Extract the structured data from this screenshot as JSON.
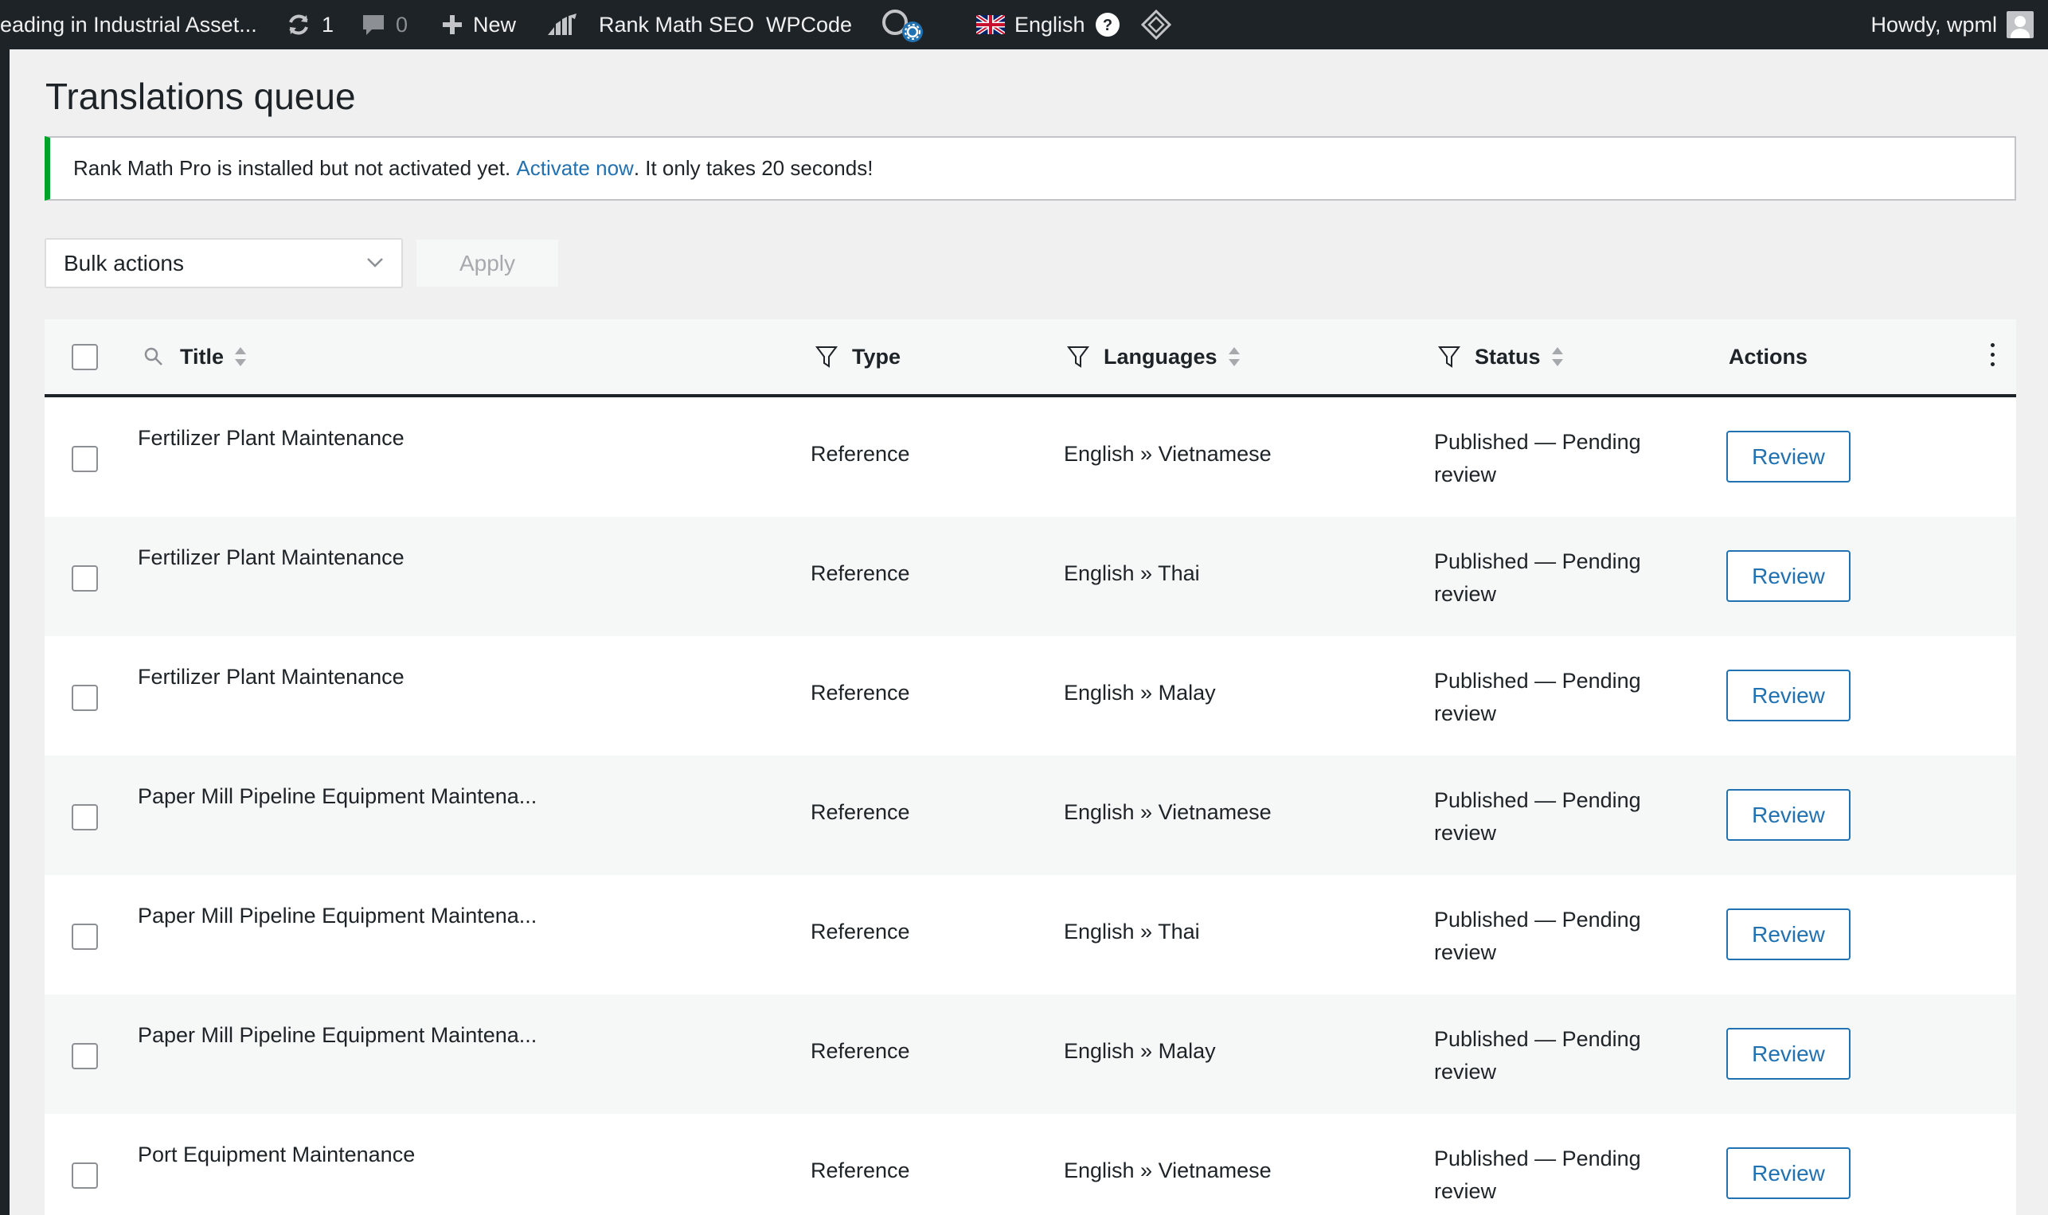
{
  "admin_bar": {
    "site_name": "eading in Industrial Asset...",
    "updates_count": "1",
    "comments_count": "0",
    "new_label": "New",
    "rank_math_label": "Rank Math SEO",
    "wpcode_label": "WPCode",
    "language_label": "English",
    "greeting": "Howdy, wpml"
  },
  "page": {
    "title": "Translations queue"
  },
  "notice": {
    "text_before": "Rank Math Pro is installed but not activated yet. ",
    "link_text": "Activate now",
    "text_after": ". It only takes 20 seconds!"
  },
  "bulk": {
    "select_label": "Bulk actions",
    "apply_label": "Apply"
  },
  "table": {
    "columns": {
      "title": "Title",
      "type": "Type",
      "languages": "Languages",
      "status": "Status",
      "actions": "Actions"
    },
    "rows": [
      {
        "title": "Fertilizer Plant Maintenance",
        "type": "Reference",
        "languages": "English » Vietnamese",
        "status": "Published — Pending review",
        "action": "Review"
      },
      {
        "title": "Fertilizer Plant Maintenance",
        "type": "Reference",
        "languages": "English » Thai",
        "status": "Published — Pending review",
        "action": "Review"
      },
      {
        "title": "Fertilizer Plant Maintenance",
        "type": "Reference",
        "languages": "English » Malay",
        "status": "Published — Pending review",
        "action": "Review"
      },
      {
        "title": "Paper Mill Pipeline Equipment Maintena...",
        "type": "Reference",
        "languages": "English » Vietnamese",
        "status": "Published — Pending review",
        "action": "Review"
      },
      {
        "title": "Paper Mill Pipeline Equipment Maintena...",
        "type": "Reference",
        "languages": "English » Thai",
        "status": "Published — Pending review",
        "action": "Review"
      },
      {
        "title": "Paper Mill Pipeline Equipment Maintena...",
        "type": "Reference",
        "languages": "English » Malay",
        "status": "Published — Pending review",
        "action": "Review"
      },
      {
        "title": "Port Equipment Maintenance",
        "type": "Reference",
        "languages": "English » Vietnamese",
        "status": "Published — Pending review",
        "action": "Review"
      }
    ]
  },
  "colors": {
    "admin_bar_bg": "#1d2327",
    "link": "#2271b1",
    "notice_accent": "#00a32a"
  }
}
